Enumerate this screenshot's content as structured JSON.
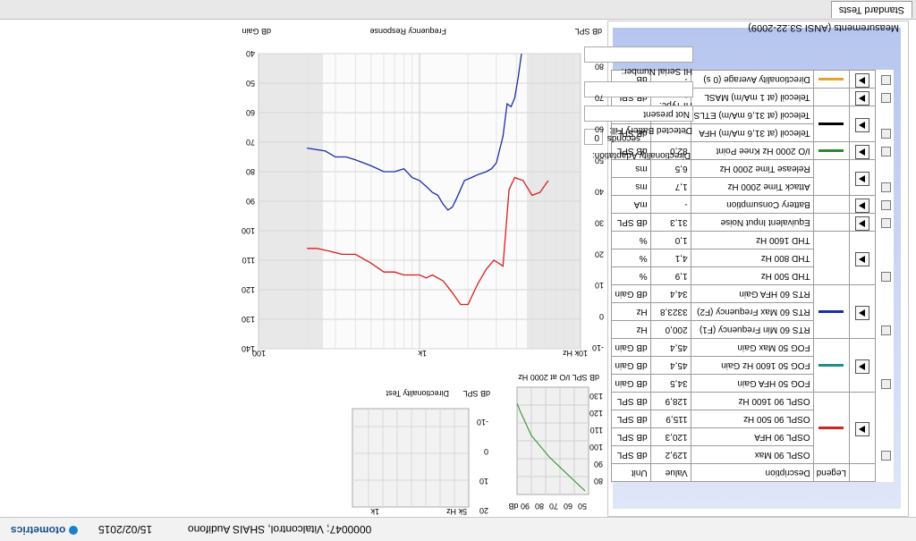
{
  "titlebar": {
    "patient": "0000047; Vitalcontrol, SHAIS Audifono",
    "date": "15/02/2015",
    "logo": "otometrics"
  },
  "tabs": [
    "Standard Tests"
  ],
  "panel": {
    "title": "Measurements (ANSI S3.22-2009)",
    "columns": [
      "Legend",
      "Description",
      "Value",
      "Unit"
    ],
    "rows": [
      {
        "desc": "OSPL 90 Max",
        "value": "129,2",
        "unit": "dB SPL"
      },
      {
        "desc": "OSPL 90 HFA",
        "value": "120,3",
        "unit": "dB SPL"
      },
      {
        "desc": "OSPL 90 500 Hz",
        "value": "115,9",
        "unit": "dB SPL"
      },
      {
        "desc": "OSPL 90 1600 Hz",
        "value": "128,9",
        "unit": "dB SPL"
      },
      {
        "desc": "FOG 50 HFA Gain",
        "value": "34,5",
        "unit": "dB Gain"
      },
      {
        "desc": "FOG 50 1600 Hz Gain",
        "value": "45,4",
        "unit": "dB Gain"
      },
      {
        "desc": "FOG 50 Max Gain",
        "value": "45,4",
        "unit": "dB Gain"
      },
      {
        "desc": "RTS 60 Min Frequency (F1)",
        "value": "200,0",
        "unit": "Hz"
      },
      {
        "desc": "RTS 60 Max Frequency (F2)",
        "value": "3323,8",
        "unit": "Hz"
      },
      {
        "desc": "RTS 60 HFA Gain",
        "value": "34,4",
        "unit": "dB Gain"
      },
      {
        "desc": "THD 500 Hz",
        "value": "1,9",
        "unit": "%"
      },
      {
        "desc": "THD 800 Hz",
        "value": "4,1",
        "unit": "%"
      },
      {
        "desc": "THD 1600 Hz",
        "value": "1,0",
        "unit": "%"
      },
      {
        "desc": "Equivalent Input Noise",
        "value": "31,3",
        "unit": "dB SPL"
      },
      {
        "desc": "Battery Consumption",
        "value": "-",
        "unit": "mA"
      },
      {
        "desc": "Attack Time 2000 Hz",
        "value": "1,7",
        "unit": "ms"
      },
      {
        "desc": "Release Time 2000 Hz",
        "value": "6,5",
        "unit": "ms"
      },
      {
        "desc": "I/O 2000 Hz Knee Point",
        "value": "82,0",
        "unit": "dB SPL"
      },
      {
        "desc": "Telecoil (at 31,6 mA/m) HFA",
        "value": "-",
        "unit": "dB SPL"
      },
      {
        "desc": "Telecoil (at 31,6 mA/m) ETLS",
        "value": "-",
        "unit": "dB"
      },
      {
        "desc": "Telecoil (at 1 mA/m) MASL",
        "value": "-",
        "unit": "dB SPL"
      },
      {
        "desc": "Directionality Average (0 s)",
        "value": "-",
        "unit": "dB"
      }
    ],
    "legend_colors": {
      "ospl": "#d42020",
      "fog": "#1a9090",
      "rts": "#1a2ea8",
      "io": "#2a8a2a",
      "tele": "#000000",
      "dir": "#f0a020"
    }
  },
  "io_chart": {
    "xlabel": "dB SPL I/O at 2000 Hz",
    "x_ticks": [
      "50",
      "60",
      "70",
      "80",
      "90 dB"
    ],
    "y_ticks": [
      "80",
      "90",
      "100",
      "110",
      "120",
      "130"
    ]
  },
  "dir_chart": {
    "xlabel": "Directionality Test",
    "x_ticks": [
      "1k",
      "5k Hz"
    ],
    "y_ticks": [
      "-10",
      "0",
      "10",
      "20"
    ],
    "unit_label": "dB SPL"
  },
  "fields": {
    "hi_serial_label": "HI Serial Number:",
    "hi_serial_value": "",
    "hi_type_label": "HI Type:",
    "hi_type_value": "",
    "battery_label": "Detected Battery Fill:",
    "battery_value": "Not present",
    "dir_adapt_label": "Directionality Adaptation:",
    "dir_adapt_value": "0",
    "dir_adapt_unit": "seconds"
  },
  "freq_chart": {
    "xlabel": "Frequency Response",
    "left_unit": "dB SPL",
    "right_unit": "dB Gain",
    "x_ticks": [
      "100",
      "1k",
      "10k Hz"
    ],
    "left_ticks": [
      "40",
      "50",
      "60",
      "70",
      "80",
      "90",
      "100",
      "110",
      "120",
      "130",
      "140"
    ],
    "right_ticks": [
      "-10",
      "0",
      "10",
      "20",
      "30",
      "40",
      "50",
      "60",
      "70",
      "80"
    ]
  },
  "chart_data": {
    "type": "line",
    "xlabel": "Frequency Response",
    "ylabel": "dB SPL",
    "y2label": "dB Gain",
    "x_scale": "log",
    "xlim": [
      100,
      10000
    ],
    "ylim": [
      40,
      140
    ],
    "y2lim": [
      -10,
      80
    ],
    "series": [
      {
        "axis": "left",
        "color": "#d42020",
        "x": [
          200,
          230,
          280,
          330,
          400,
          500,
          600,
          700,
          800,
          900,
          1000,
          1100,
          1200,
          1400,
          1600,
          1800,
          2000,
          2300,
          2600,
          2900,
          3100,
          3300,
          3600,
          3900,
          4400,
          5000,
          5600,
          6300
        ],
        "y": [
          106,
          106,
          107,
          108,
          108,
          111,
          114,
          114,
          115,
          115,
          115,
          116,
          115,
          117,
          121,
          125,
          125,
          118,
          113,
          110,
          111,
          112,
          86,
          82,
          83,
          88,
          87,
          83
        ]
      },
      {
        "axis": "left",
        "color": "#1a2ea8",
        "x": [
          200,
          260,
          300,
          350,
          400,
          500,
          600,
          700,
          800,
          900,
          1000,
          1100,
          1200,
          1300,
          1400,
          1500,
          1600,
          1700,
          1800,
          1900,
          2100,
          2300,
          2600,
          2800,
          3000,
          3300,
          3500,
          3700,
          3900,
          4100,
          4300
        ],
        "y": [
          72,
          73,
          75,
          75,
          76,
          78,
          80,
          80,
          79,
          82,
          83,
          85,
          87,
          88,
          91,
          93,
          92,
          89,
          86,
          83,
          82,
          81,
          80,
          79,
          77,
          68,
          57,
          58,
          55,
          48,
          40
        ]
      }
    ]
  }
}
